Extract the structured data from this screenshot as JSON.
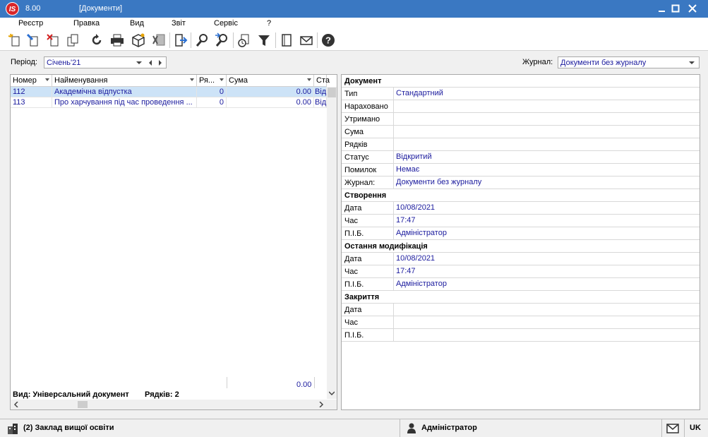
{
  "window": {
    "app_icon_text": "IS",
    "version": "8.00",
    "title": "[Документи]",
    "colors": {
      "titlebar": "#3a78c2",
      "value_text": "#1b1b9e",
      "selection": "#cde3f7"
    }
  },
  "menu": [
    "Реєстр",
    "Правка",
    "Вид",
    "Звіт",
    "Сервіс",
    "?"
  ],
  "toolbar": {
    "icons": [
      "new-document-icon",
      "edit-icon",
      "delete-icon",
      "copy-icon",
      "refresh-icon",
      "print-icon",
      "package-icon",
      "export-excel-icon",
      "exit-icon",
      "search-icon",
      "search-next-icon",
      "calendar-clock-icon",
      "filter-icon",
      "notebook-icon",
      "mail-icon",
      "help-icon"
    ]
  },
  "filters": {
    "period_label": "Період:",
    "period_value": "Січень'21",
    "journal_label": "Журнал:",
    "journal_value": "Документи без журналу"
  },
  "grid": {
    "columns": [
      "Номер",
      "Найменування",
      "Ря...",
      "Сума",
      "Ста"
    ],
    "rows": [
      {
        "number": "112",
        "name": "Академічна відпустка",
        "rows": "0",
        "sum": "0.00",
        "status": "Від"
      },
      {
        "number": "113",
        "name": "Про харчування під час проведення ...",
        "rows": "0",
        "sum": "0.00",
        "status": "Від"
      }
    ],
    "total": "0.00",
    "view_label": "Вид: Універсальний документ",
    "rows_label": "Рядків: 2"
  },
  "properties": {
    "document_header": "Документ",
    "type_label": "Тип",
    "type_value": "Стандартний",
    "accrued_label": "Нараховано",
    "accrued_value": "",
    "withheld_label": "Утримано",
    "withheld_value": "",
    "sum_label": "Сума",
    "sum_value": "",
    "rows_label": "Рядків",
    "rows_value": "",
    "status_label": "Статус",
    "status_value": "Відкритий",
    "errors_label": "Помилок",
    "errors_value": "Немає",
    "journal_label": "Журнал:",
    "journal_value": "Документи без журналу",
    "created_header": "Створення",
    "created_date_label": "Дата",
    "created_date": "10/08/2021",
    "created_time_label": "Час",
    "created_time": "17:47",
    "created_user_label": "П.І.Б.",
    "created_user": "Адміністратор",
    "modified_header": "Остання модифікація",
    "modified_date_label": "Дата",
    "modified_date": "10/08/2021",
    "modified_time_label": "Час",
    "modified_time": "17:47",
    "modified_user_label": "П.І.Б.",
    "modified_user": "Адміністратор",
    "closed_header": "Закриття",
    "closed_date_label": "Дата",
    "closed_date": "",
    "closed_time_label": "Час",
    "closed_time": "",
    "closed_user_label": "П.І.Б.",
    "closed_user": ""
  },
  "statusbar": {
    "organization": "(2) Заклад вищої освіти",
    "user": "Адміністратор",
    "language": "UK"
  }
}
